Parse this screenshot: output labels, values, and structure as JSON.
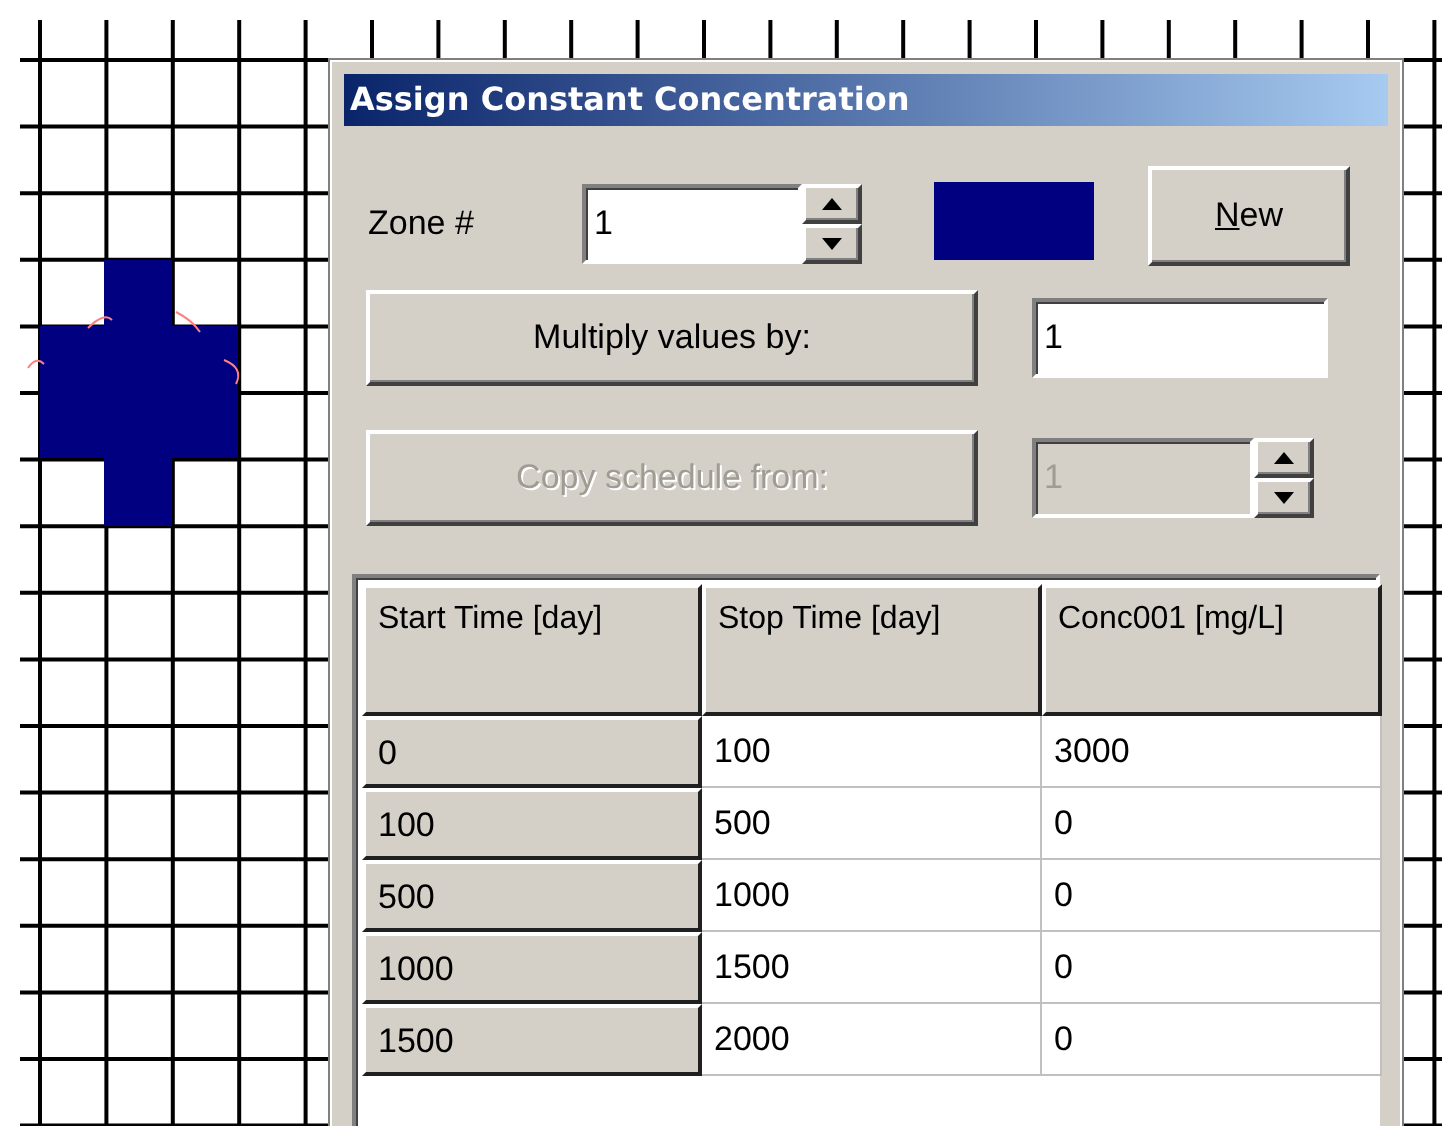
{
  "window": {
    "title": "Assign Constant Concentration"
  },
  "zone": {
    "label": "Zone #",
    "value": "1",
    "color": "#000080"
  },
  "new_button": {
    "mnemonic": "N",
    "label_rest": "ew"
  },
  "multiply": {
    "label": "Multiply values by:",
    "value": "1"
  },
  "copy_schedule": {
    "label": "Copy schedule from:",
    "value": "1",
    "disabled": true
  },
  "table": {
    "columns": [
      "Start Time [day]",
      "Stop Time [day]",
      "Conc001 [mg/L]"
    ],
    "rows": [
      [
        "0",
        "100",
        "3000"
      ],
      [
        "100",
        "500",
        "0"
      ],
      [
        "500",
        "1000",
        "0"
      ],
      [
        "1000",
        "1500",
        "0"
      ],
      [
        "1500",
        "2000",
        "0"
      ]
    ]
  }
}
